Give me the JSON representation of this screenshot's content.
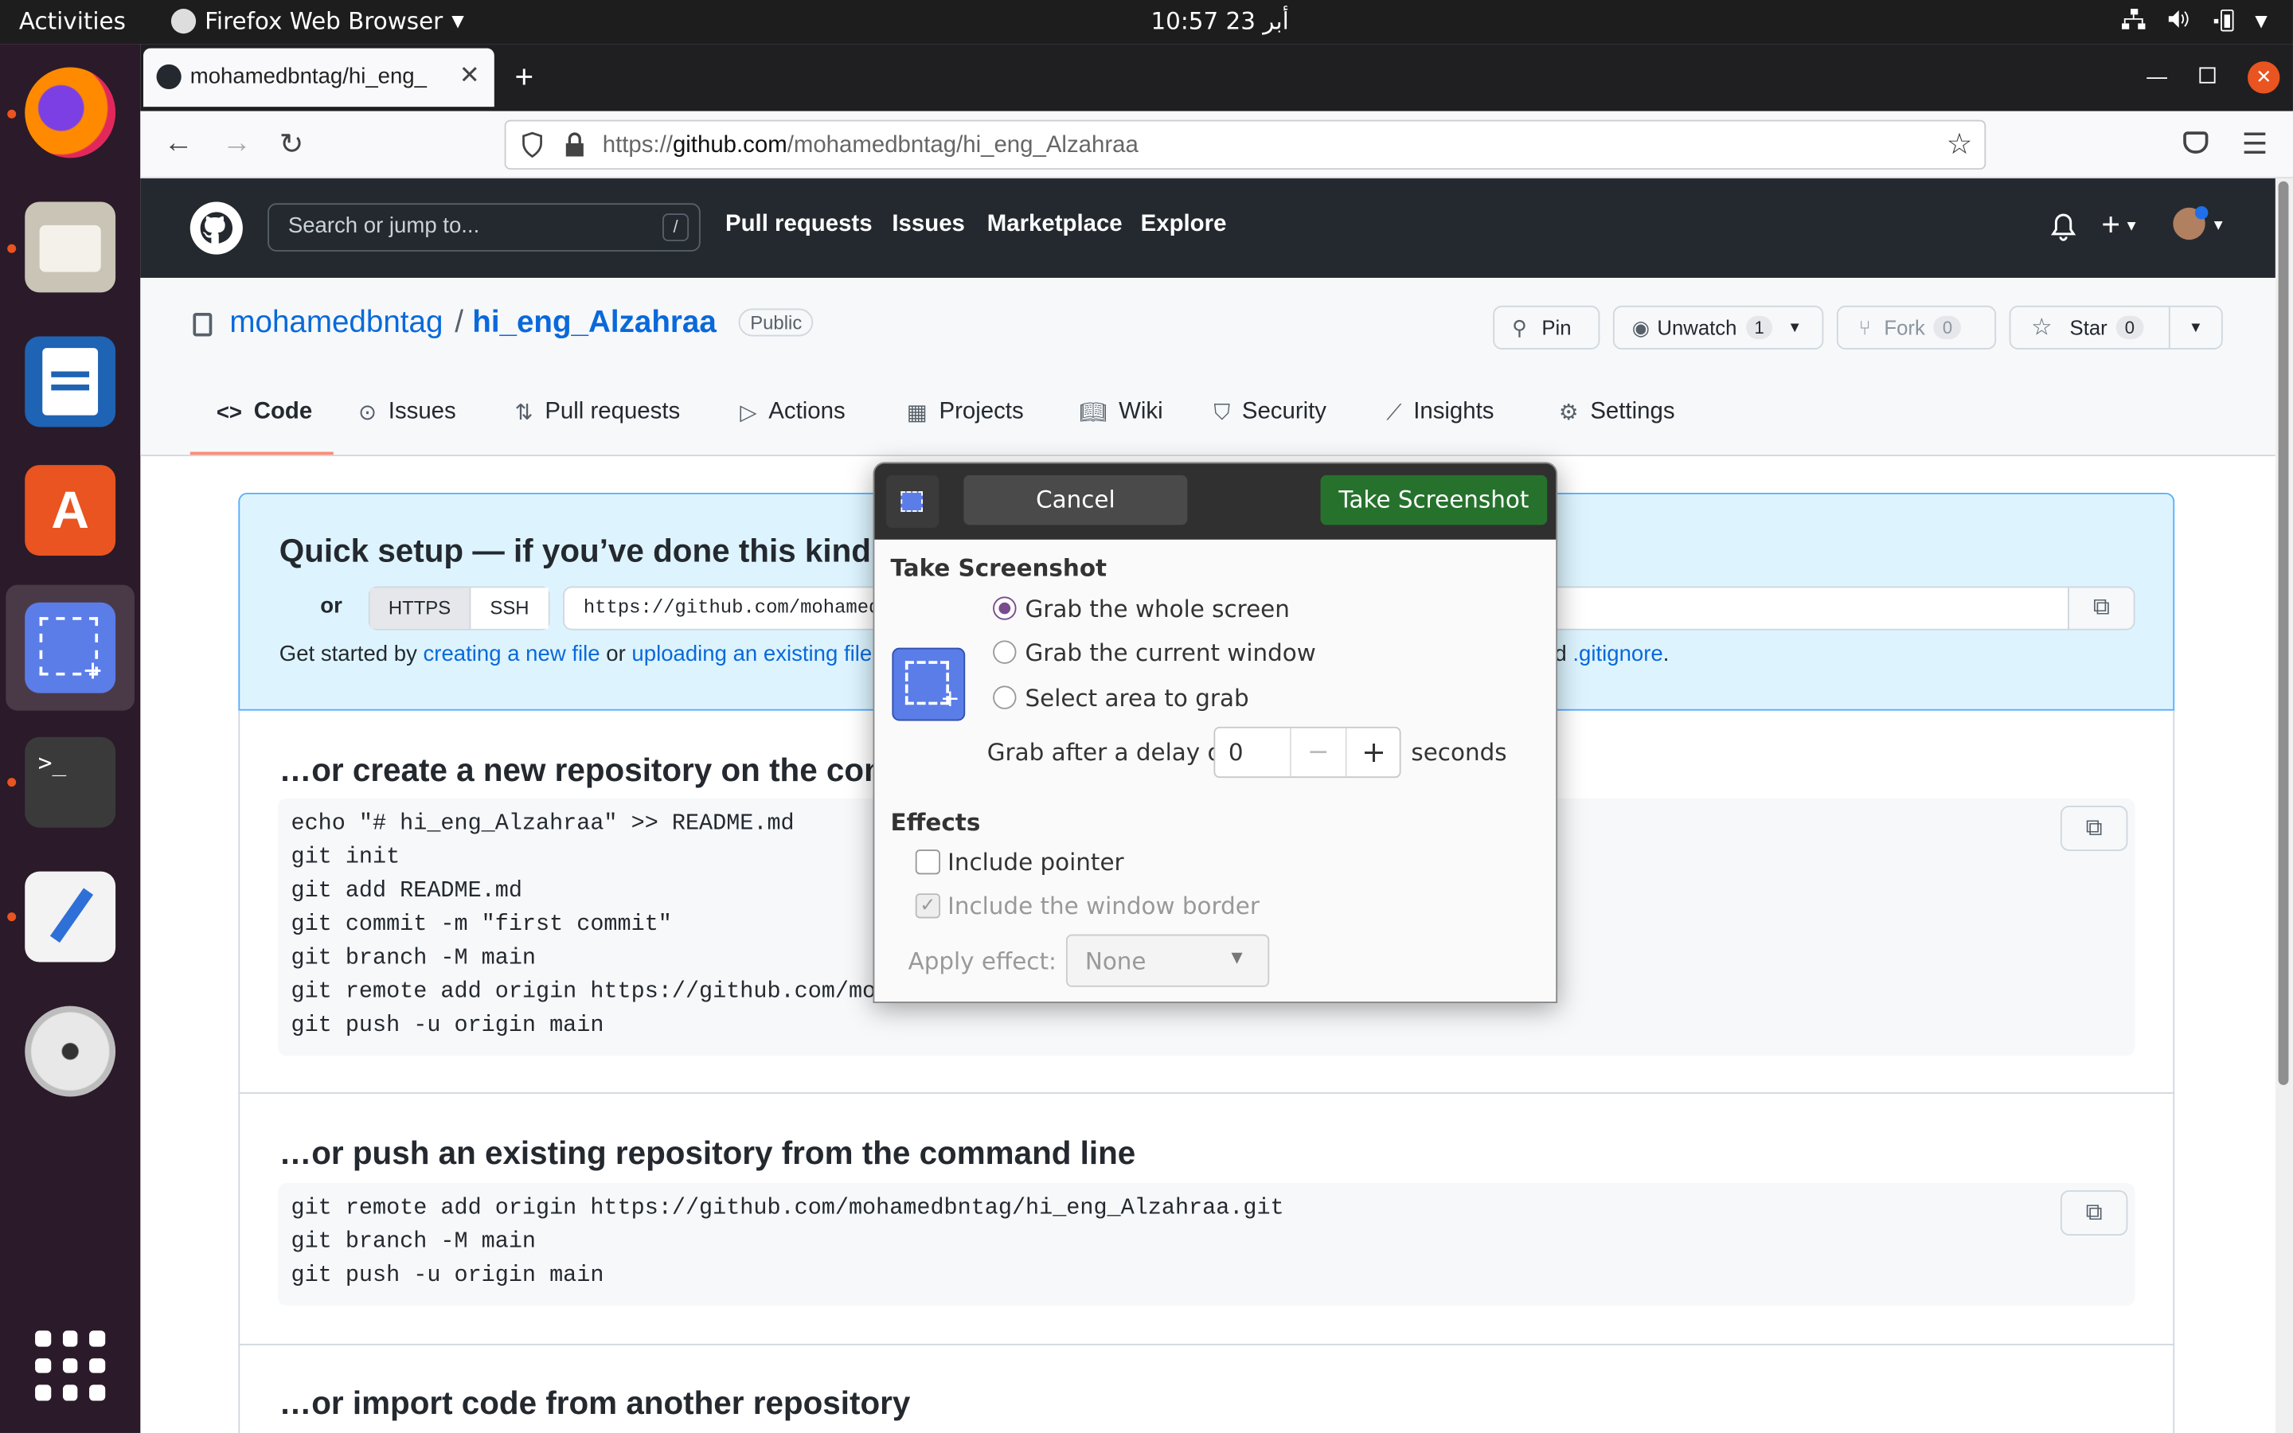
{
  "system": {
    "activities": "Activities",
    "app_name": "Firefox Web Browser",
    "clock": "10:57  23 أبر"
  },
  "browser": {
    "tab_title": "mohamedbntag/hi_eng_",
    "url_prefix": "https://",
    "url_host": "github.com",
    "url_path": "/mohamedbntag/hi_eng_Alzahraa"
  },
  "github": {
    "search_placeholder": "Search or jump to...",
    "search_shortcut": "/",
    "nav": [
      "Pull requests",
      "Issues",
      "Marketplace",
      "Explore"
    ]
  },
  "repo": {
    "owner": "mohamedbntag",
    "separator": "/",
    "name": "hi_eng_Alzahraa",
    "visibility": "Public",
    "pin_label": "Pin",
    "unwatch_label": "Unwatch",
    "unwatch_count": "1",
    "fork_label": "Fork",
    "fork_count": "0",
    "star_label": "Star",
    "star_count": "0",
    "tabs": [
      "Code",
      "Issues",
      "Pull requests",
      "Actions",
      "Projects",
      "Wiki",
      "Security",
      "Insights",
      "Settings"
    ]
  },
  "quick_setup": {
    "title": "Quick setup — if you’ve done this kind",
    "or": "or",
    "https": "HTTPS",
    "ssh": "SSH",
    "clone_url": "https://github.com/mohamed",
    "started_prefix": "Get started by",
    "link_new_file": "creating a new file",
    "or2": "or",
    "link_upload": "uploading an existing file",
    "suffix_d": "d",
    "link_gitignore": ".gitignore",
    "period": "."
  },
  "section_new": {
    "title": "…or create a new repository on the com",
    "code": "echo \"# hi_eng_Alzahraa\" >> README.md\ngit init\ngit add README.md\ngit commit -m \"first commit\"\ngit branch -M main\ngit remote add origin https://github.com/moh\ngit push -u origin main"
  },
  "section_push": {
    "title": "…or push an existing repository from the command line",
    "code": "git remote add origin https://github.com/mohamedbntag/hi_eng_Alzahraa.git\ngit branch -M main\ngit push -u origin main"
  },
  "section_import": {
    "title": "…or import code from another repository"
  },
  "dialog": {
    "cancel": "Cancel",
    "take": "Take Screenshot",
    "heading": "Take Screenshot",
    "opt_whole": "Grab the whole screen",
    "opt_window": "Grab the current window",
    "opt_area": "Select area to grab",
    "delay_label": "Grab after a delay of",
    "delay_value": "0",
    "seconds": "seconds",
    "effects": "Effects",
    "include_pointer": "Include pointer",
    "include_border": "Include the window border",
    "apply_effect": "Apply effect:",
    "effect_value": "None",
    "selected_option": "whole",
    "include_pointer_checked": false,
    "include_border_checked": true
  },
  "colors": {
    "github_header": "#24292f",
    "accent_blue": "#0969da",
    "take_button": "#26722d",
    "ubuntu_orange": "#e95420"
  }
}
